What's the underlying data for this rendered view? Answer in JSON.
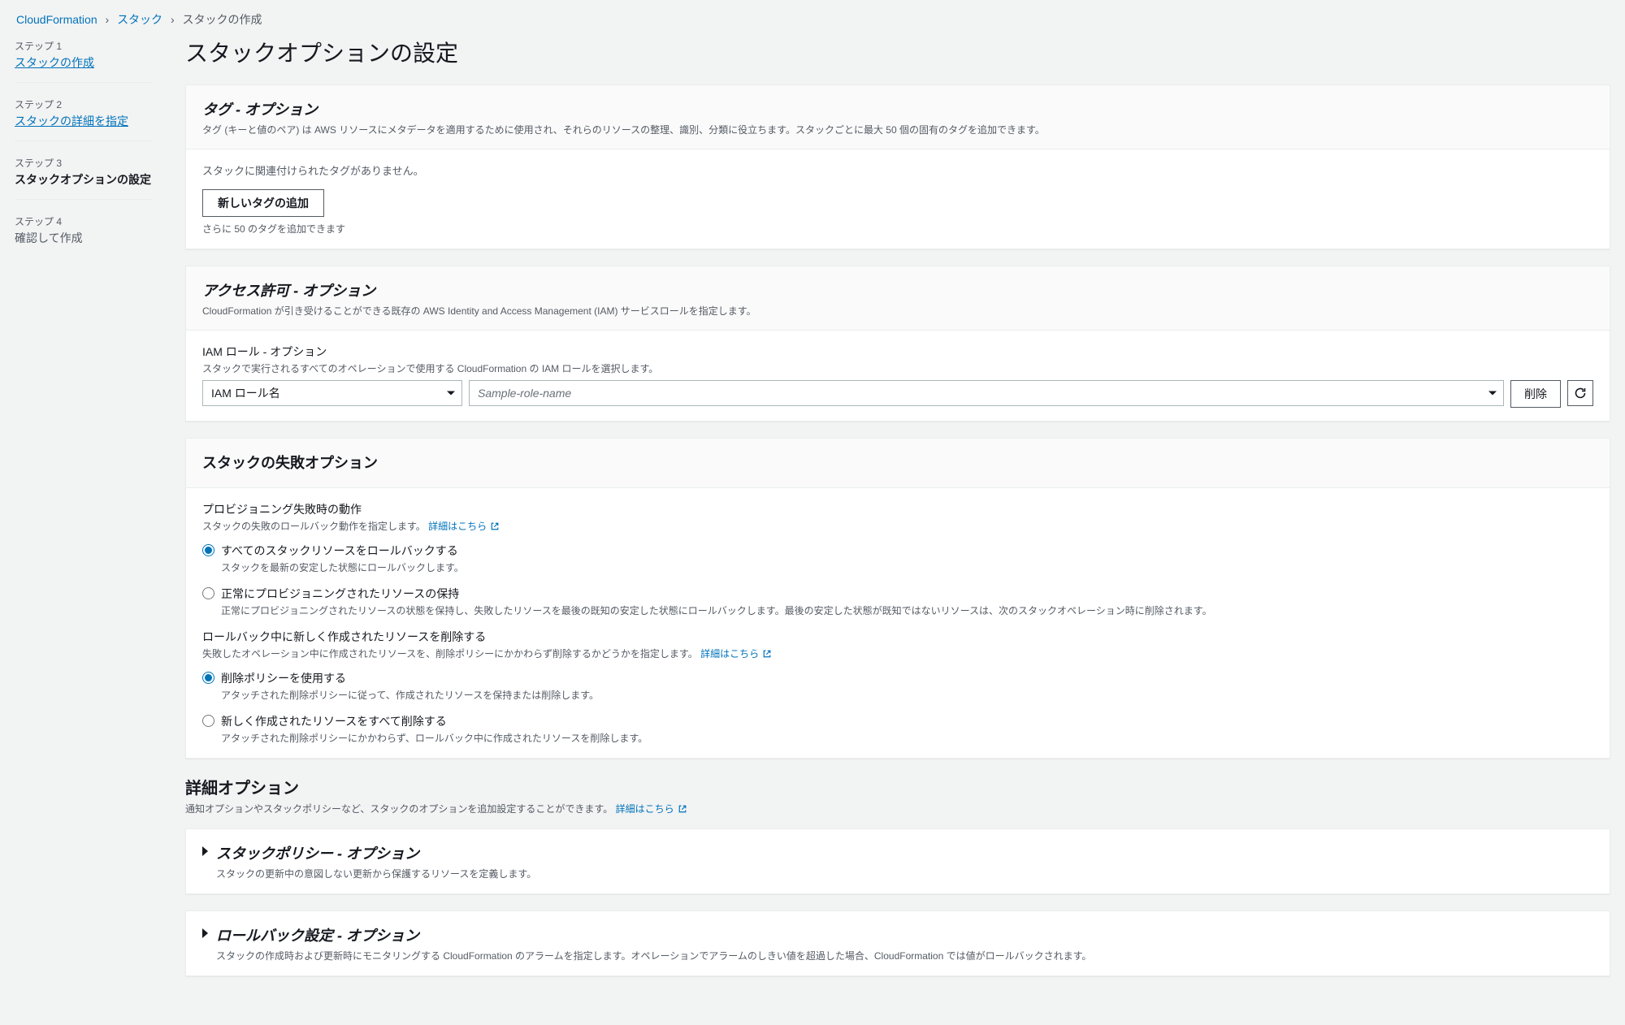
{
  "breadcrumb": {
    "items": [
      "CloudFormation",
      "スタック"
    ],
    "current": "スタックの作成"
  },
  "steps": [
    {
      "label": "ステップ 1",
      "title": "スタックの作成",
      "state": "link"
    },
    {
      "label": "ステップ 2",
      "title": "スタックの詳細を指定",
      "state": "link"
    },
    {
      "label": "ステップ 3",
      "title": "スタックオプションの設定",
      "state": "current"
    },
    {
      "label": "ステップ 4",
      "title": "確認して作成",
      "state": "future"
    }
  ],
  "page_title": "スタックオプションの設定",
  "tags": {
    "title": "タグ - オプション",
    "desc": "タグ (キーと値のペア) は AWS リソースにメタデータを適用するために使用され、それらのリソースの整理、識別、分類に役立ちます。スタックごとに最大 50 個の固有のタグを追加できます。",
    "empty": "スタックに関連付けられたタグがありません。",
    "add_btn": "新しいタグの追加",
    "hint": "さらに 50 のタグを追加できます"
  },
  "perm": {
    "title": "アクセス許可 - オプション",
    "desc": "CloudFormation が引き受けることができる既存の AWS Identity and Access Management (IAM) サービスロールを指定します。",
    "field_label": "IAM ロール - オプション",
    "field_desc": "スタックで実行されるすべてのオペレーションで使用する CloudFormation の IAM ロールを選択します。",
    "select1": "IAM ロール名",
    "select2_placeholder": "Sample-role-name",
    "delete_btn": "削除"
  },
  "failure": {
    "title": "スタックの失敗オプション",
    "prov_title": "プロビジョニング失敗時の動作",
    "prov_desc": "スタックの失敗のロールバック動作を指定します。",
    "learn": "詳細はこちら",
    "opt_a": {
      "t": "すべてのスタックリソースをロールバックする",
      "d": "スタックを最新の安定した状態にロールバックします。"
    },
    "opt_b": {
      "t": "正常にプロビジョニングされたリソースの保持",
      "d": "正常にプロビジョニングされたリソースの状態を保持し、失敗したリソースを最後の既知の安定した状態にロールバックします。最後の安定した状態が既知ではないリソースは、次のスタックオペレーション時に削除されます。"
    },
    "rb_title": "ロールバック中に新しく作成されたリソースを削除する",
    "rb_desc": "失敗したオペレーション中に作成されたリソースを、削除ポリシーにかかわらず削除するかどうかを指定します。",
    "opt_c": {
      "t": "削除ポリシーを使用する",
      "d": "アタッチされた削除ポリシーに従って、作成されたリソースを保持または削除します。"
    },
    "opt_d": {
      "t": "新しく作成されたリソースをすべて削除する",
      "d": "アタッチされた削除ポリシーにかかわらず、ロールバック中に作成されたリソースを削除します。"
    }
  },
  "adv": {
    "title": "詳細オプション",
    "desc": "通知オプションやスタックポリシーなど、スタックのオプションを追加設定することができます。",
    "learn": "詳細はこちら",
    "sp": {
      "title": "スタックポリシー - オプション",
      "desc": "スタックの更新中の意図しない更新から保護するリソースを定義します。"
    },
    "rb": {
      "title": "ロールバック設定 - オプション",
      "desc": "スタックの作成時および更新時にモニタリングする CloudFormation のアラームを指定します。オペレーションでアラームのしきい値を超過した場合、CloudFormation では値がロールバックされます。"
    }
  }
}
